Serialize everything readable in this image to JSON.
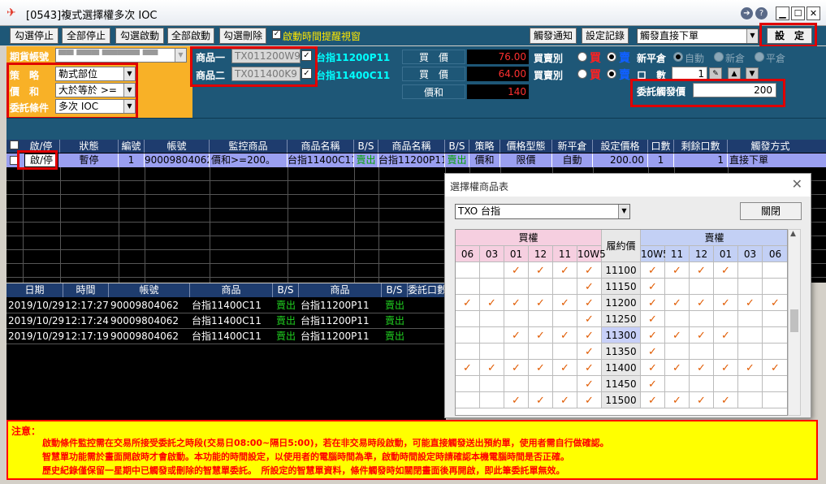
{
  "window": {
    "title": "[0543]複式選擇權多次 IOC",
    "help": "?",
    "nav": "➔"
  },
  "toolbar": {
    "buttons": [
      "勾選停止",
      "全部停止",
      "勾選啟動",
      "全部啟動",
      "勾選刪除"
    ],
    "popup_check_label": "啟動時間提醒視窗",
    "popup_check_state": "✓",
    "notify_btn": "觸發通知",
    "log_btn": "設定記錄",
    "trigger_mode": "觸發直接下單",
    "set_btn": "設　定"
  },
  "form": {
    "account_label": "期貨帳號",
    "account_value": "▀▀ ▀▀▀ ▀▀▀▀▀ ▀▀",
    "strategy_label": "策　略",
    "strategy_value": "勒式部位",
    "price_sum_label": "價　和",
    "price_sum_value": "大於等於 >=",
    "condition_label": "委託條件",
    "condition_value": "多次 IOC",
    "product1_label": "商品一",
    "product1_code": "TX011200W9",
    "product1_name": "台指11200P11",
    "product2_label": "商品二",
    "product2_code": "TX011400K9",
    "product2_name": "台指11400C11",
    "buy_price_label": "買　價",
    "buy_price_value": "76.00",
    "sell_price_label": "買　價",
    "sell_price_value": "64.00",
    "sum_label": "價和",
    "sum_value": "140",
    "side_label": "買賣別",
    "buy_char": "買",
    "sell_char": "賣",
    "newclose_label": "新平倉",
    "opt_auto": "自動",
    "opt_new": "新倉",
    "opt_close": "平倉",
    "qty_label": "口　數",
    "qty_value": "1",
    "trigger_label": "委託觸發價",
    "trigger_value": "200"
  },
  "grid": {
    "headers": [
      "啟/停",
      "狀態",
      "編號",
      "帳號",
      "監控商品",
      "商品名稱",
      "B/S",
      "商品名稱",
      "B/S",
      "策略",
      "價格型態",
      "新平倉",
      "設定價格",
      "口數",
      "剩餘口數",
      "觸發方式"
    ],
    "row": {
      "toggle": "啟/停",
      "status": "暫停",
      "id": "1",
      "account": "90009804062",
      "monitor": "價和>=200。",
      "name1": "台指11400C11",
      "bs1": "賣出",
      "name2": "台指11200P11",
      "bs2": "賣出",
      "strategy": "價和",
      "price_type": "限價",
      "newclose": "自動",
      "price": "200.00",
      "qty": "1",
      "remain": "1",
      "trigger": "直接下單"
    }
  },
  "history": {
    "headers": [
      "日期",
      "時間",
      "帳號",
      "商品",
      "B/S",
      "商品",
      "B/S",
      "委託口數"
    ],
    "rows": [
      [
        "2019/10/29",
        "12:17:27",
        "90009804062",
        "台指11400C11",
        "賣出",
        "台指11200P11",
        "賣出"
      ],
      [
        "2019/10/29",
        "12:17:24",
        "90009804062",
        "台指11400C11",
        "賣出",
        "台指11200P11",
        "賣出"
      ],
      [
        "2019/10/29",
        "12:17:19",
        "90009804062",
        "台指11400C11",
        "賣出",
        "台指11200P11",
        "賣出"
      ]
    ]
  },
  "popup": {
    "title": "選擇權商品表",
    "close": "✕",
    "product": "TXO 台指",
    "close_btn": "關閉",
    "call_label": "買權",
    "put_label": "賣權",
    "strike_label": "履約價",
    "call_months": [
      "06",
      "03",
      "01",
      "12",
      "11",
      "10W5"
    ],
    "put_months": [
      "10W5",
      "11",
      "12",
      "01",
      "03",
      "06"
    ],
    "strikes": [
      "11100",
      "11150",
      "11200",
      "11250",
      "11300",
      "11350",
      "11400",
      "11450",
      "11500"
    ],
    "call_ticks": [
      [
        0,
        0,
        1,
        1,
        1,
        1
      ],
      [
        0,
        0,
        0,
        0,
        0,
        1
      ],
      [
        1,
        1,
        1,
        1,
        1,
        1
      ],
      [
        0,
        0,
        0,
        0,
        0,
        1
      ],
      [
        0,
        0,
        1,
        1,
        1,
        1
      ],
      [
        0,
        0,
        0,
        0,
        0,
        1
      ],
      [
        1,
        1,
        1,
        1,
        1,
        1
      ],
      [
        0,
        0,
        0,
        0,
        0,
        1
      ],
      [
        0,
        0,
        1,
        1,
        1,
        1
      ]
    ],
    "put_ticks": [
      [
        1,
        1,
        1,
        1,
        0,
        0
      ],
      [
        1,
        0,
        0,
        0,
        0,
        0
      ],
      [
        1,
        1,
        1,
        1,
        1,
        1
      ],
      [
        1,
        0,
        0,
        0,
        0,
        0
      ],
      [
        1,
        1,
        1,
        1,
        0,
        0
      ],
      [
        1,
        0,
        0,
        0,
        0,
        0
      ],
      [
        1,
        1,
        1,
        1,
        1,
        1
      ],
      [
        1,
        0,
        0,
        0,
        0,
        0
      ],
      [
        1,
        1,
        1,
        1,
        0,
        0
      ]
    ],
    "tick_glyph": "✓"
  },
  "notice": {
    "title": "注意：",
    "lines": [
      "啟動條件監控需在交易所接受委託之時段(交易日08:00~隔日5:00)，若在非交易時段啟動，可能直接觸發送出預約單，使用者需自行做確認。",
      "智慧單功能需於畫面開啟時才會啟動。本功能的時間設定，以使用者的電腦時間為準，啟動時間設定時請確認本機電腦時間是否正確。",
      "歷史紀錄僅保留一星期中已觸發或刪除的智慧單委託。　所設定的智慧單資料，條件觸發時如關閉畫面後再開啟，即此筆委託單無效。"
    ]
  },
  "colors": {
    "panel": "#1e5777",
    "accent": "#f8b127",
    "alert": "#ff0000"
  }
}
